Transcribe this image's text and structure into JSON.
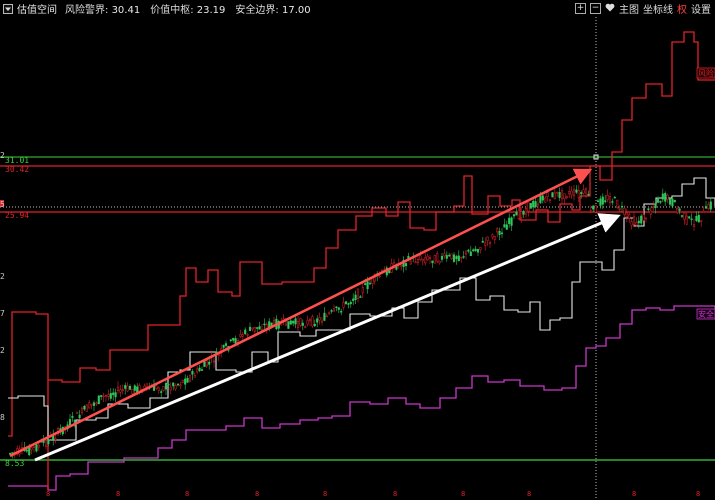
{
  "header": {
    "title": "估值空间",
    "items": [
      {
        "label": "风险警界:",
        "value": "30.41"
      },
      {
        "label": "价值中枢:",
        "value": "23.19"
      },
      {
        "label": "安全边界:",
        "value": "17.00"
      }
    ]
  },
  "controls": {
    "plus_label": "+",
    "minus_label": "−",
    "main_label": "主图",
    "coord_label": "坐标线",
    "right_label": "权",
    "settings_label": "设置"
  },
  "chart_data": {
    "type": "line",
    "y_tick_labels": [
      "31.01",
      "30.42",
      "25.94",
      "8.53"
    ],
    "y_tick_fragments": [
      "2",
      "5",
      "2",
      "7",
      "2",
      "8"
    ],
    "x_tick_labels": [
      "8",
      "8",
      "8",
      "8",
      "8",
      "8",
      "8",
      "8",
      "8",
      "8"
    ],
    "series": [
      {
        "name": "风险",
        "color": "#e0222a"
      },
      {
        "name": "",
        "color": "#e8e8e8"
      },
      {
        "name": "安全",
        "color": "#c838c8"
      }
    ],
    "green_line_levels": [
      "31.01",
      "8.53"
    ],
    "colors": {
      "risk": "#e0222a",
      "value": "#e8e8e8",
      "safety": "#c838c8",
      "green_line": "#3cd23c",
      "arrow_red": "#ff5050",
      "arrow_white": "#ffffff"
    }
  }
}
